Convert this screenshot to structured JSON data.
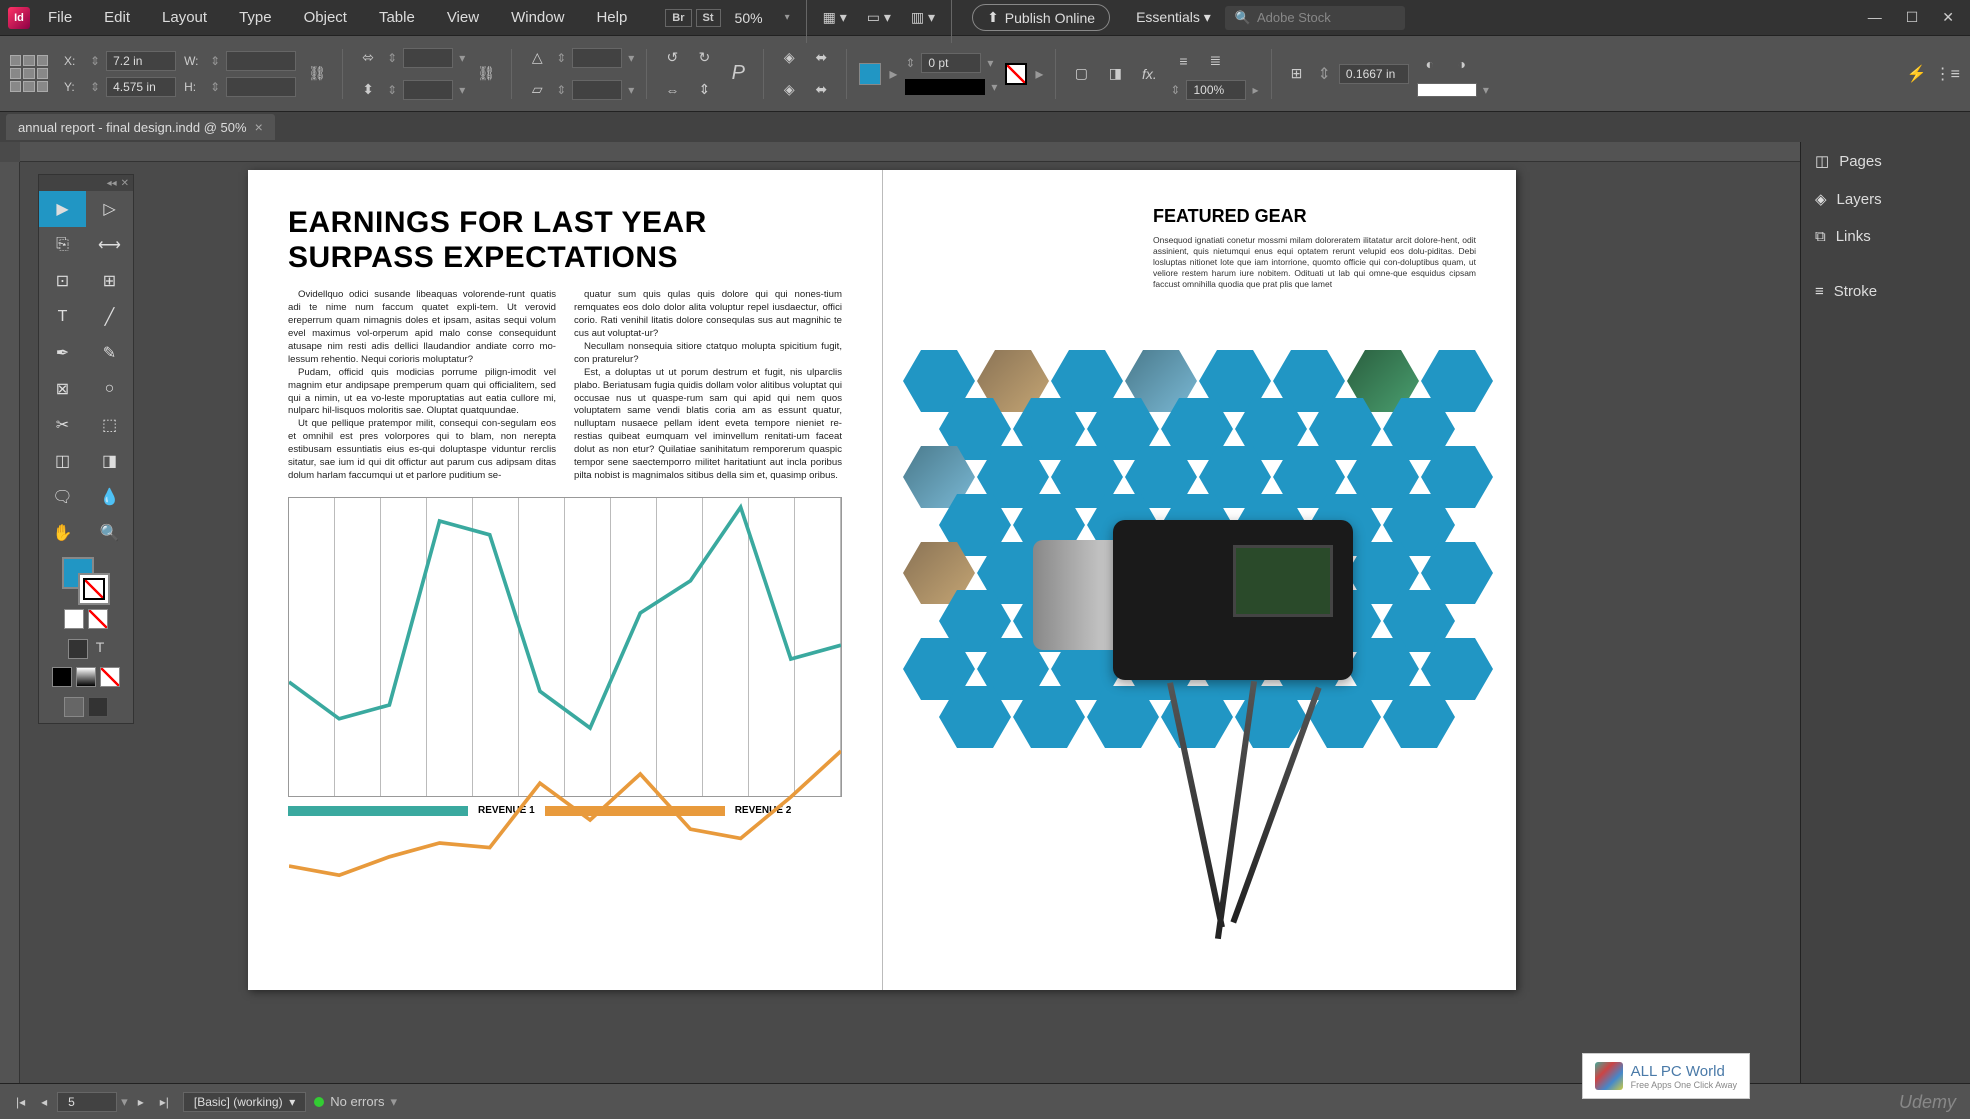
{
  "app": {
    "initials": "Id"
  },
  "menu": {
    "file": "File",
    "edit": "Edit",
    "layout": "Layout",
    "type": "Type",
    "object": "Object",
    "table": "Table",
    "view": "View",
    "window": "Window",
    "help": "Help"
  },
  "toolbar": {
    "br": "Br",
    "st": "St",
    "zoom": "50%",
    "publish": "Publish Online",
    "workspace": "Essentials",
    "search_placeholder": "Adobe Stock"
  },
  "control": {
    "x_label": "X:",
    "x_value": "7.2 in",
    "y_label": "Y:",
    "y_value": "4.575 in",
    "w_label": "W:",
    "w_value": "",
    "h_label": "H:",
    "h_value": "",
    "stroke_weight": "0 pt",
    "opacity": "100%",
    "leading": "0.1667 in"
  },
  "tab": {
    "title": "annual report - final design.indd @ 50%"
  },
  "panels": {
    "pages": "Pages",
    "layers": "Layers",
    "links": "Links",
    "stroke": "Stroke"
  },
  "status": {
    "page": "5",
    "preset": "[Basic] (working)",
    "errors": "No errors"
  },
  "doc": {
    "headline": "EARNINGS FOR LAST YEAR SURPASS EXPECTATIONS",
    "body_p1": "Ovidellquo odici susande libeaquas volorende-runt quatis adi te nime num faccum quatet expli-tem. Ut verovid ereperrum quam nimagnis doles et ipsam, asitas sequi volum evel maximus vol-orperum apid malo conse consequidunt atusape nim resti adis dellici llaudandior andiate corro mo-lessum rehentio. Nequi corioris moluptatur?",
    "body_p2": "Pudam, officid quis modicias porrume pilign-imodit vel magnim etur andipsape premperum quam qui officialitem, sed qui a nimin, ut ea vo-leste mporuptatias aut eatia cullore mi, nulparc hil-lisquos moloritis sae. Oluptat quatquundae.",
    "body_p3": "Ut que pellique pratempor milit, consequi con-segulam eos et omnihil est pres volorpores qui to blam, non nerepta estibusam essuntiatis eius es-qui doluptaspe viduntur rerclis sitatur, sae ium id qui dit offictur aut parum cus adipsam ditas dolum harlam faccumqui ut et parlore puditium se-",
    "body_p4": "quatur sum quis qulas quis dolore qui qui nones-tium remquates eos dolo dolor alita voluptur repel iusdaectur, offici corio. Rati venihil litatis dolore consequlas sus aut magnihic te cus aut voluptat-ur?",
    "body_p5": "Necullam nonsequia sitiore ctatquo molupta spicitium fugit, con praturelur?",
    "body_p6": "Est, a doluptas ut ut porum destrum et fugit, nis ulparclis plabo. Beriatusam fugia quidis dollam volor alitibus voluptat qui occusae nus ut quaspe-rum sam qui apid qui nem quos voluptatem same vendi blatis coria am as essunt quatur, nulluptam nusaece pellam ident eveta tempore nieniet re-restias quibeat eumquam vel iminvellum renitati-um faceat dolut as non etur? Quilatiae sanihitatum remporerum quaspic tempor sene saectemporro militet haritatiunt aut incla poribus pilta nobist is magnimalos sitibus della sim et, quasimp oribus.",
    "legend1": "REVENUE 1",
    "legend2": "REVENUE 2",
    "subhead": "FEATURED GEAR",
    "caption": "Onsequod ignatiati conetur mossmi milam doloreratem ilitatatur arcit dolore-hent, odit assinient, quis nietumqui enus equi optatem rerunt velupid eos dolu-piditas. Debi losluptas nitionet lote que iam intorrione, quomto officie qui con-doluptibus quam, ut veliore restem harum iure nobitem. Odituati ut lab qui omne-que esquidus cipsam faccust omnihilla quodia que prat plis que lamet"
  },
  "chart_data": {
    "type": "line",
    "x": [
      1,
      2,
      3,
      4,
      5,
      6,
      7,
      8,
      9,
      10,
      11,
      12
    ],
    "series": [
      {
        "name": "REVENUE 1",
        "color": "#3aa99f",
        "values": [
          60,
          52,
          55,
          95,
          92,
          58,
          50,
          75,
          82,
          98,
          65,
          68
        ]
      },
      {
        "name": "REVENUE 2",
        "color": "#e89a3c",
        "values": [
          20,
          18,
          22,
          25,
          24,
          38,
          30,
          40,
          28,
          26,
          35,
          45
        ]
      }
    ],
    "ylim": [
      0,
      100
    ]
  },
  "watermark": {
    "title": "ALL PC World",
    "sub": "Free Apps One Click Away"
  },
  "udemy": "Udemy"
}
